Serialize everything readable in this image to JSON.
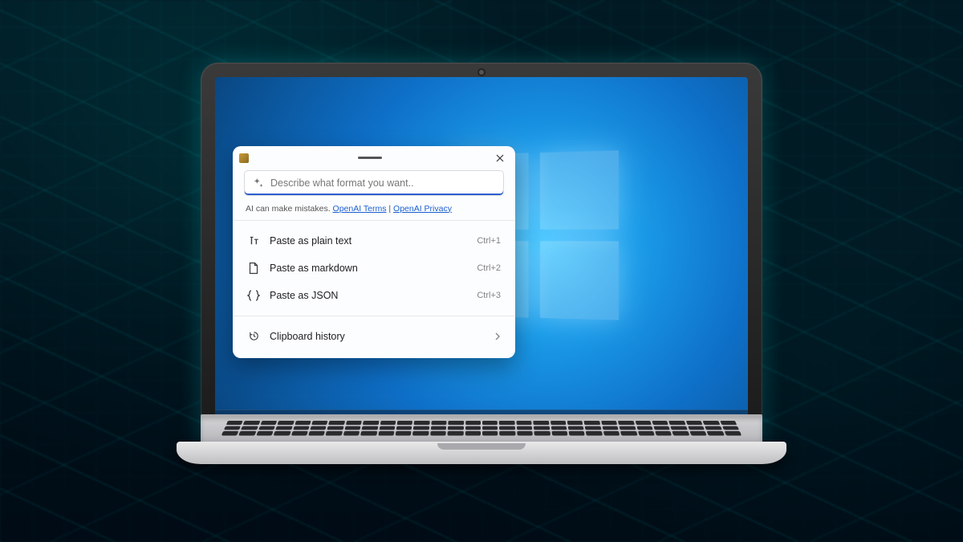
{
  "search": {
    "placeholder": "Describe what format you want..",
    "value": ""
  },
  "disclaimer": {
    "prefix": "AI can make mistakes. ",
    "terms": "OpenAI Terms",
    "sep": " | ",
    "privacy": "OpenAI Privacy"
  },
  "options": [
    {
      "icon": "text-icon",
      "label": "Paste as plain text",
      "shortcut": "Ctrl+1"
    },
    {
      "icon": "markdown-icon",
      "label": "Paste as markdown",
      "shortcut": "Ctrl+2"
    },
    {
      "icon": "json-icon",
      "label": "Paste as JSON",
      "shortcut": "Ctrl+3"
    }
  ],
  "history": {
    "label": "Clipboard history"
  }
}
